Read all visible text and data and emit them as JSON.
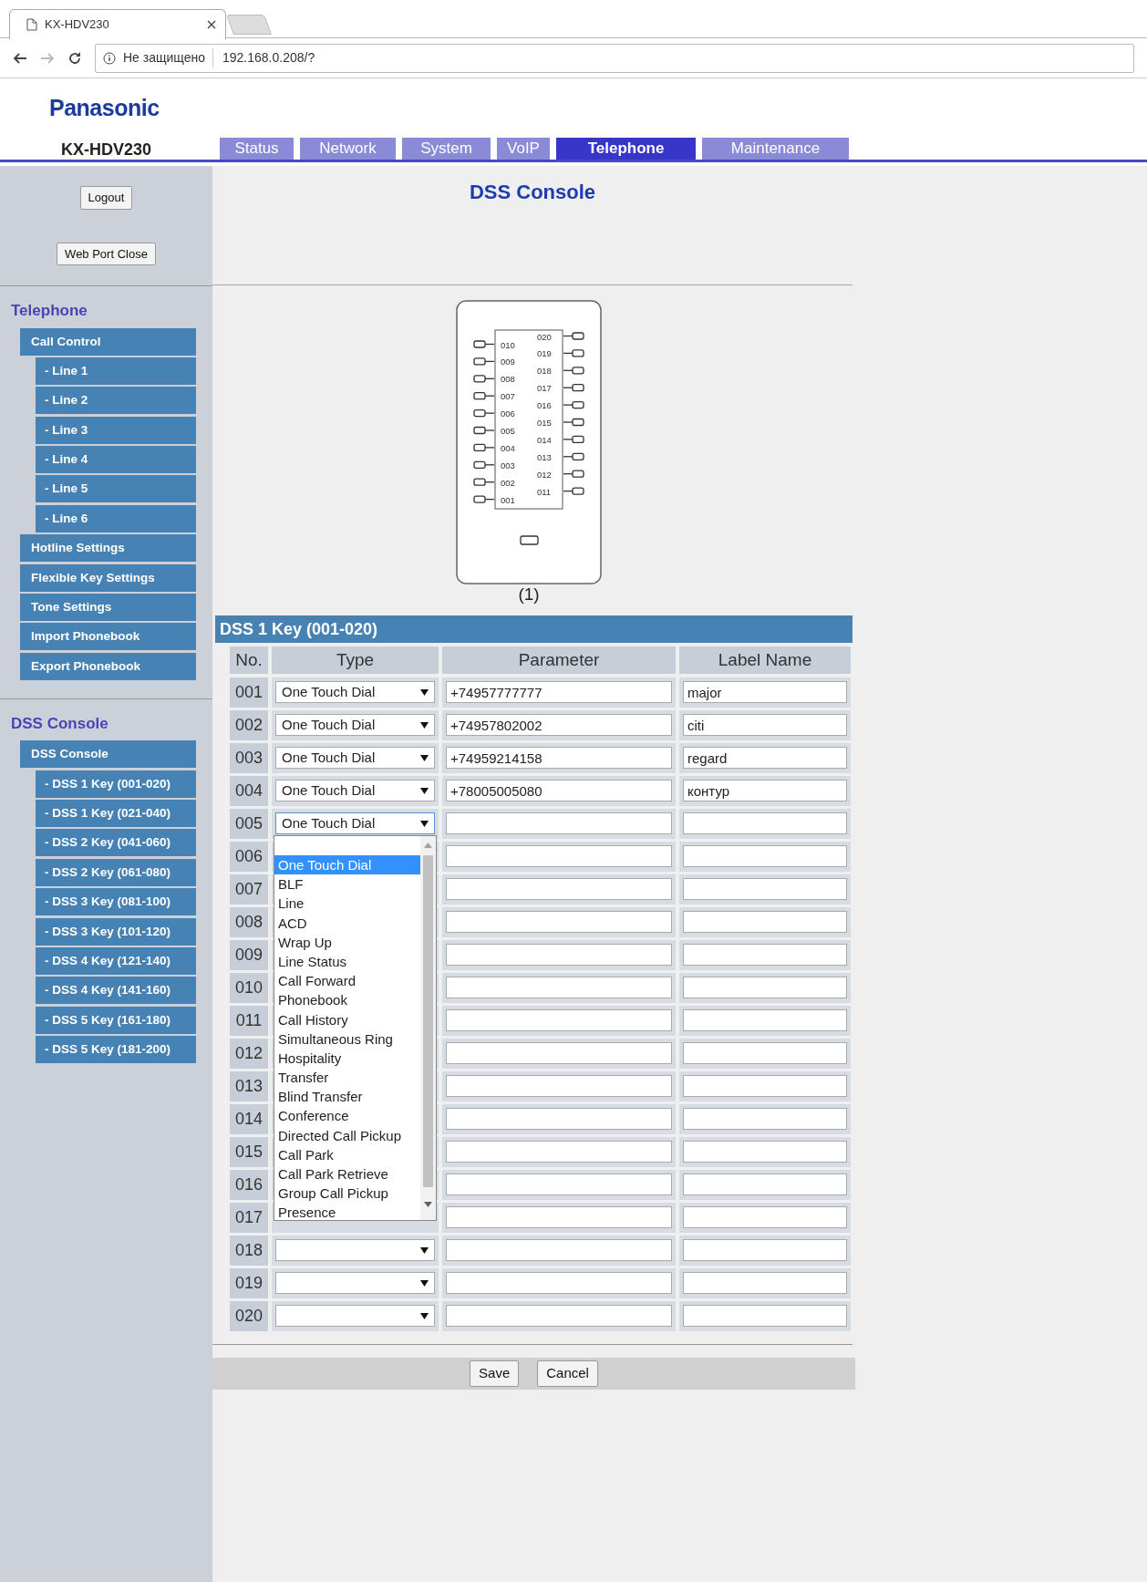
{
  "browser": {
    "tab_title": "KX-HDV230",
    "security": "Не защищено",
    "url": "192.168.0.208/?"
  },
  "header": {
    "brand": "Panasonic",
    "model": "KX-HDV230"
  },
  "tabs": [
    {
      "label": "Status",
      "selected": false
    },
    {
      "label": "Network",
      "selected": false
    },
    {
      "label": "System",
      "selected": false
    },
    {
      "label": "VoIP",
      "selected": false
    },
    {
      "label": "Telephone",
      "selected": true
    },
    {
      "label": "Maintenance",
      "selected": false
    }
  ],
  "sidebar": {
    "buttons": [
      "Logout",
      "Web Port Close"
    ],
    "sections": [
      {
        "heading": "Telephone",
        "items": [
          {
            "label": "Call Control",
            "children": [
              {
                "label": "- Line 1"
              },
              {
                "label": "- Line 2"
              },
              {
                "label": "- Line 3"
              },
              {
                "label": "- Line 4"
              },
              {
                "label": "- Line 5"
              },
              {
                "label": "- Line 6"
              }
            ]
          },
          {
            "label": "Hotline Settings"
          },
          {
            "label": "Flexible Key Settings"
          },
          {
            "label": "Tone Settings"
          },
          {
            "label": "Import Phonebook"
          },
          {
            "label": "Export Phonebook"
          }
        ]
      },
      {
        "heading": "DSS Console",
        "items": [
          {
            "label": "DSS Console",
            "children": [
              {
                "label": "- DSS 1 Key (001-020)"
              },
              {
                "label": "- DSS 1 Key (021-040)"
              },
              {
                "label": "- DSS 2 Key (041-060)"
              },
              {
                "label": "- DSS 2 Key (061-080)"
              },
              {
                "label": "- DSS 3 Key (081-100)"
              },
              {
                "label": "- DSS 3 Key (101-120)"
              },
              {
                "label": "- DSS 4 Key (121-140)"
              },
              {
                "label": "- DSS 4 Key (141-160)"
              },
              {
                "label": "- DSS 5 Key (161-180)"
              },
              {
                "label": "- DSS 5 Key (181-200)"
              }
            ]
          }
        ]
      }
    ]
  },
  "page_title": "DSS Console",
  "console": {
    "left_keys": [
      "010",
      "009",
      "008",
      "007",
      "006",
      "005",
      "004",
      "003",
      "002",
      "001"
    ],
    "right_keys": [
      "020",
      "019",
      "018",
      "017",
      "016",
      "015",
      "014",
      "013",
      "012",
      "011"
    ],
    "caption": "(1)"
  },
  "table": {
    "title": "DSS 1 Key (001-020)",
    "columns": [
      "No.",
      "Type",
      "Parameter",
      "Label Name"
    ],
    "rows": [
      {
        "no": "001",
        "kind": "select",
        "type": "One Touch Dial",
        "open": false,
        "parameter": "+74957777777",
        "label_name": "major"
      },
      {
        "no": "002",
        "kind": "select",
        "type": "One Touch Dial",
        "open": false,
        "parameter": "+74957802002",
        "label_name": "citi"
      },
      {
        "no": "003",
        "kind": "select",
        "type": "One Touch Dial",
        "open": false,
        "parameter": "+74959214158",
        "label_name": "regard"
      },
      {
        "no": "004",
        "kind": "select",
        "type": "One Touch Dial",
        "open": false,
        "parameter": "+78005005080",
        "label_name": "контур"
      },
      {
        "no": "005",
        "kind": "select",
        "type": "One Touch Dial",
        "open": true
      },
      {
        "no": "006",
        "kind": "covered"
      },
      {
        "no": "007",
        "kind": "covered"
      },
      {
        "no": "008",
        "kind": "covered"
      },
      {
        "no": "009",
        "kind": "covered"
      },
      {
        "no": "010",
        "kind": "covered"
      },
      {
        "no": "011",
        "kind": "covered"
      },
      {
        "no": "012",
        "kind": "covered"
      },
      {
        "no": "013",
        "kind": "covered"
      },
      {
        "no": "014",
        "kind": "covered"
      },
      {
        "no": "015",
        "kind": "covered"
      },
      {
        "no": "016",
        "kind": "covered"
      },
      {
        "no": "017",
        "kind": "covered"
      },
      {
        "no": "018",
        "kind": "select",
        "open": false
      },
      {
        "no": "019",
        "kind": "select",
        "open": false
      },
      {
        "no": "020",
        "kind": "select",
        "open": false
      }
    ]
  },
  "type_dropdown": {
    "options": [
      {
        "label": "One Touch Dial",
        "selected": true
      },
      {
        "label": "BLF",
        "selected": false
      },
      {
        "label": "Line",
        "selected": false
      },
      {
        "label": "ACD",
        "selected": false
      },
      {
        "label": "Wrap Up",
        "selected": false
      },
      {
        "label": "Line Status",
        "selected": false
      },
      {
        "label": "Call Forward",
        "selected": false
      },
      {
        "label": "Phonebook",
        "selected": false
      },
      {
        "label": "Call History",
        "selected": false
      },
      {
        "label": "Simultaneous Ring",
        "selected": false
      },
      {
        "label": "Hospitality",
        "selected": false
      },
      {
        "label": "Transfer",
        "selected": false
      },
      {
        "label": "Blind Transfer",
        "selected": false
      },
      {
        "label": "Conference",
        "selected": false
      },
      {
        "label": "Directed Call Pickup",
        "selected": false
      },
      {
        "label": "Call Park",
        "selected": false
      },
      {
        "label": "Call Park Retrieve",
        "selected": false
      },
      {
        "label": "Group Call Pickup",
        "selected": false
      },
      {
        "label": "Presence",
        "selected": false
      }
    ]
  },
  "footer_buttons": [
    "Save",
    "Cancel"
  ]
}
